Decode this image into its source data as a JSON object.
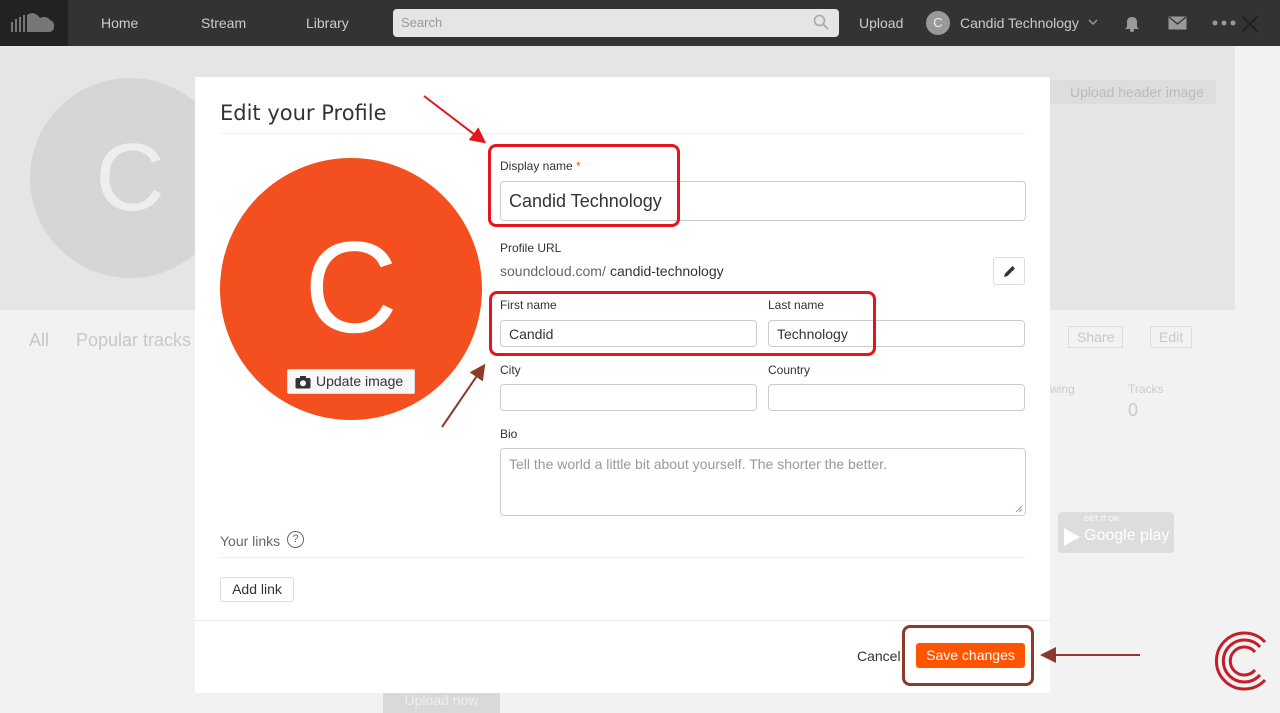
{
  "nav": {
    "home": "Home",
    "stream": "Stream",
    "library": "Library",
    "search_placeholder": "Search",
    "upload": "Upload",
    "avatar_letter": "C",
    "username": "Candid Technology"
  },
  "profile_bg": {
    "avatar_letter": "C",
    "upload_header_image": "Upload header image",
    "tab_all": "All",
    "tab_popular": "Popular tracks",
    "share": "Share",
    "edit": "Edit",
    "following_label": "wing",
    "tracks_label": "Tracks",
    "tracks_count": "0",
    "gplay_top": "GET IT ON",
    "gplay_main": "Google play",
    "upload_now": "Upload now"
  },
  "modal": {
    "title": "Edit your Profile",
    "avatar_letter": "C",
    "update_image": "Update image",
    "display_name_label": "Display name",
    "required_mark": "*",
    "display_name_value": "Candid Technology",
    "profile_url_label": "Profile URL",
    "profile_url_prefix": "soundcloud.com/",
    "profile_url_slug": "candid-technology",
    "first_name_label": "First name",
    "first_name_value": "Candid",
    "last_name_label": "Last name",
    "last_name_value": "Technology",
    "city_label": "City",
    "city_value": "",
    "country_label": "Country",
    "country_value": "",
    "bio_label": "Bio",
    "bio_placeholder": "Tell the world a little bit about yourself. The shorter the better.",
    "your_links": "Your links",
    "help_mark": "?",
    "add_link": "Add link",
    "cancel": "Cancel",
    "save": "Save changes"
  },
  "colors": {
    "accent": "#ff5500",
    "avatar": "#f34f1f",
    "annotation_red": "#e4161b",
    "annotation_brown": "#8c3a2a"
  }
}
